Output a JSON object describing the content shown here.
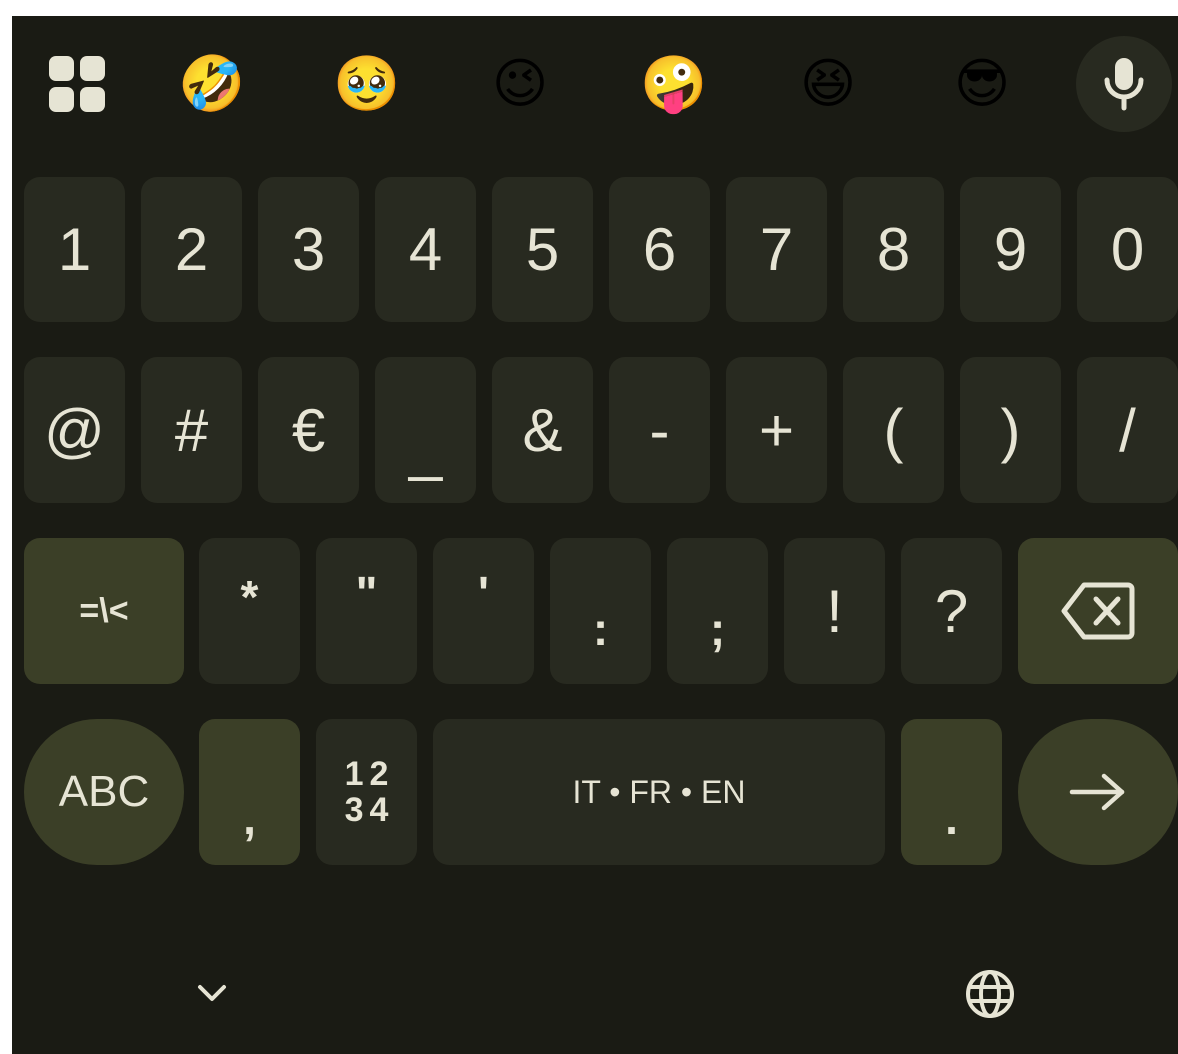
{
  "suggestion_strip": {
    "apps_icon": "apps-grid-icon",
    "emojis": [
      {
        "name": "rolling-on-floor-laughing",
        "glyph": "🤣"
      },
      {
        "name": "face-holding-back-tears",
        "glyph": "🥹"
      },
      {
        "name": "winking-face",
        "glyph": "😉"
      },
      {
        "name": "zany-face",
        "glyph": "🤪"
      },
      {
        "name": "grinning-squinting-face",
        "glyph": "😆"
      },
      {
        "name": "smiling-face-with-sunglasses",
        "glyph": "😎"
      }
    ],
    "mic_icon": "microphone-icon"
  },
  "rows": {
    "numbers": [
      "1",
      "2",
      "3",
      "4",
      "5",
      "6",
      "7",
      "8",
      "9",
      "0"
    ],
    "symbols": [
      "@",
      "#",
      "€",
      "_",
      "&",
      "-",
      "+",
      "(",
      ")",
      "/"
    ],
    "punct": {
      "more_symbols": "=\\<",
      "keys": [
        "*",
        "\"",
        "'",
        ":",
        ";",
        "!",
        "?"
      ],
      "backspace_icon": "backspace-icon"
    },
    "bottom": {
      "abc": "ABC",
      "comma": ",",
      "numpad_line1": "12",
      "numpad_line2": "34",
      "space": "IT • FR • EN",
      "period": ".",
      "enter_icon": "arrow-right-icon"
    }
  },
  "nav": {
    "hide_icon": "chevron-down-icon",
    "language_icon": "globe-icon"
  },
  "colors": {
    "background": "#1a1b14",
    "key": "#282a20",
    "accent_key": "#3b3f27",
    "text": "#e6e4d4"
  }
}
